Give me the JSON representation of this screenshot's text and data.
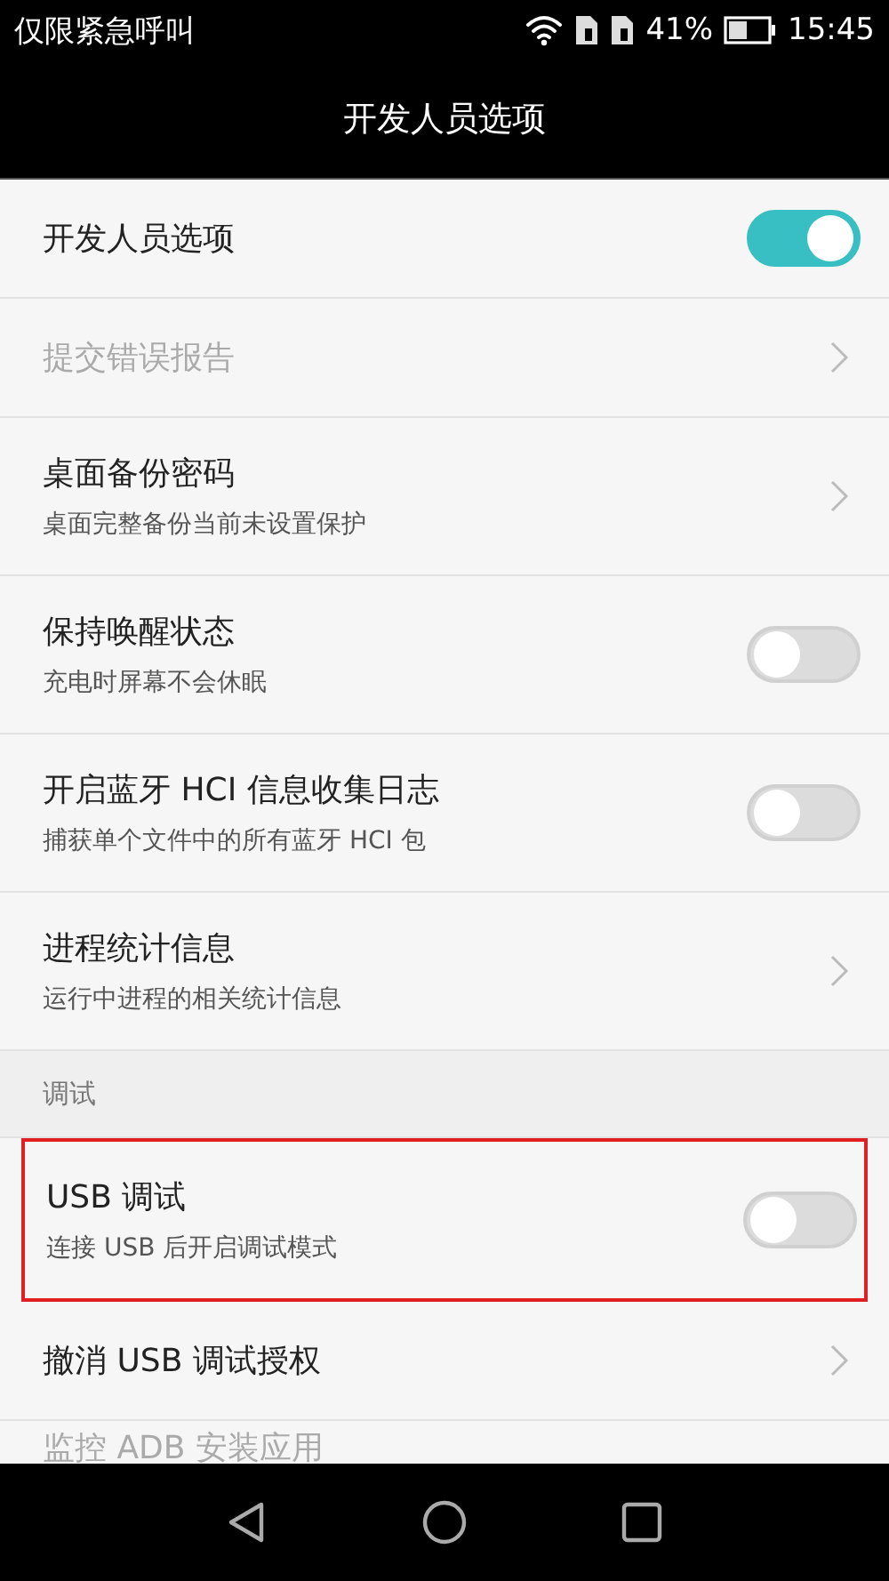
{
  "status_bar": {
    "carrier": "仅限紧急呼叫",
    "battery_text": "41%",
    "time": "15:45"
  },
  "title": "开发人员选项",
  "items": [
    {
      "kind": "toggle",
      "title": "开发人员选项",
      "on": true,
      "disabled": false,
      "highlighted": false
    },
    {
      "kind": "link",
      "title": "提交错误报告",
      "disabled": true,
      "highlighted": false
    },
    {
      "kind": "link",
      "title": "桌面备份密码",
      "subtitle": "桌面完整备份当前未设置保护",
      "disabled": false,
      "highlighted": false
    },
    {
      "kind": "toggle",
      "title": "保持唤醒状态",
      "subtitle": "充电时屏幕不会休眠",
      "on": false,
      "disabled": false,
      "highlighted": false
    },
    {
      "kind": "toggle",
      "title": "开启蓝牙 HCI 信息收集日志",
      "subtitle": "捕获单个文件中的所有蓝牙 HCI 包",
      "on": false,
      "disabled": false,
      "highlighted": false
    },
    {
      "kind": "link",
      "title": "进程统计信息",
      "subtitle": "运行中进程的相关统计信息",
      "disabled": false,
      "highlighted": false
    },
    {
      "kind": "header",
      "title": "调试"
    },
    {
      "kind": "toggle",
      "title": "USB 调试",
      "subtitle": "连接 USB 后开启调试模式",
      "on": false,
      "disabled": false,
      "highlighted": true
    },
    {
      "kind": "link",
      "title": "撤消 USB 调试授权",
      "disabled": false,
      "highlighted": false
    },
    {
      "kind": "partial",
      "title": "监控 ADB 安装应用",
      "disabled": true,
      "highlighted": false
    }
  ]
}
